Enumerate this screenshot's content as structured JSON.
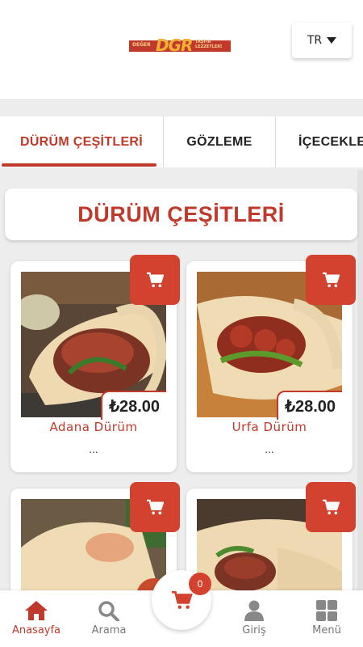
{
  "header": {
    "logo": {
      "line1": "DEĞER",
      "monogram": "DGR",
      "line2a": "TAŞFIR",
      "line2b": "LEZZETLERİ"
    },
    "language": "TR"
  },
  "tabs": [
    {
      "label": "DÜRÜM ÇEŞİTLERİ",
      "active": true
    },
    {
      "label": "GÖZLEME",
      "active": false
    },
    {
      "label": "İÇECEKLE",
      "active": false
    }
  ],
  "section_title": "DÜRÜM ÇEŞİTLERİ",
  "products": [
    {
      "name": "Adana Dürüm",
      "price": "₺28.00",
      "desc": "..."
    },
    {
      "name": "Urfa Dürüm",
      "price": "₺28.00",
      "desc": "..."
    },
    {
      "name": "",
      "price": "",
      "desc": ""
    },
    {
      "name": "",
      "price": "",
      "desc": ""
    }
  ],
  "cart": {
    "count": "0"
  },
  "bottom_nav": [
    {
      "label": "Anasayfa",
      "icon": "home-icon",
      "active": true
    },
    {
      "label": "Arama",
      "icon": "search-icon",
      "active": false
    },
    {
      "label": "Giriş",
      "icon": "user-icon",
      "active": false
    },
    {
      "label": "Menü",
      "icon": "grid-icon",
      "active": false
    }
  ],
  "colors": {
    "accent": "#c0392b",
    "button": "#d3412f",
    "background": "#ededed"
  }
}
